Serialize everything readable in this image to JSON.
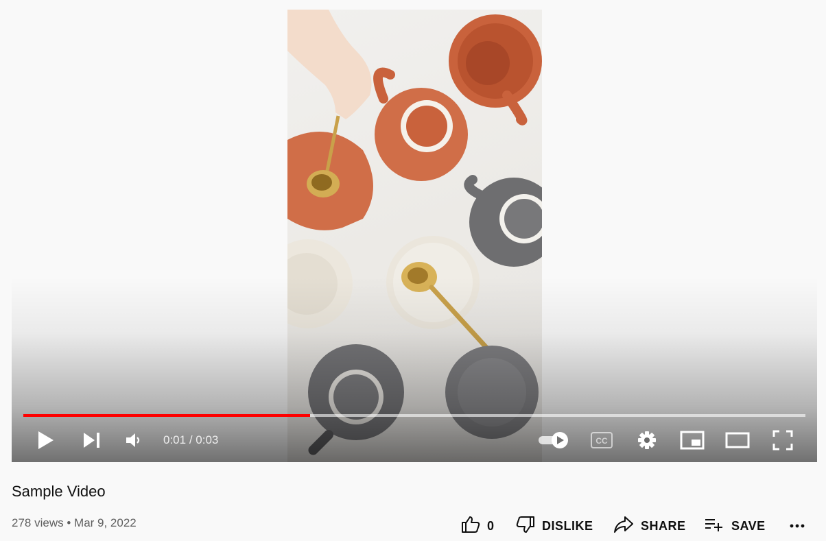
{
  "player": {
    "current_time": "0:01",
    "separator": "/",
    "duration": "0:03",
    "progress_fraction": 0.3667,
    "accent_color": "#ff0000"
  },
  "video": {
    "title": "Sample Video",
    "views": "278 views",
    "dot": "•",
    "date": "Mar 9, 2022"
  },
  "actions": {
    "like_count": "0",
    "dislike_label": "DISLIKE",
    "share_label": "SHARE",
    "save_label": "SAVE"
  },
  "icons": [
    "play-icon",
    "next-icon",
    "volume-icon",
    "autoplay-toggle-icon",
    "captions-icon",
    "settings-icon",
    "miniplayer-icon",
    "theater-icon",
    "fullscreen-icon",
    "thumbs-up-icon",
    "thumbs-down-icon",
    "share-icon",
    "playlist-add-icon",
    "more-icon"
  ]
}
